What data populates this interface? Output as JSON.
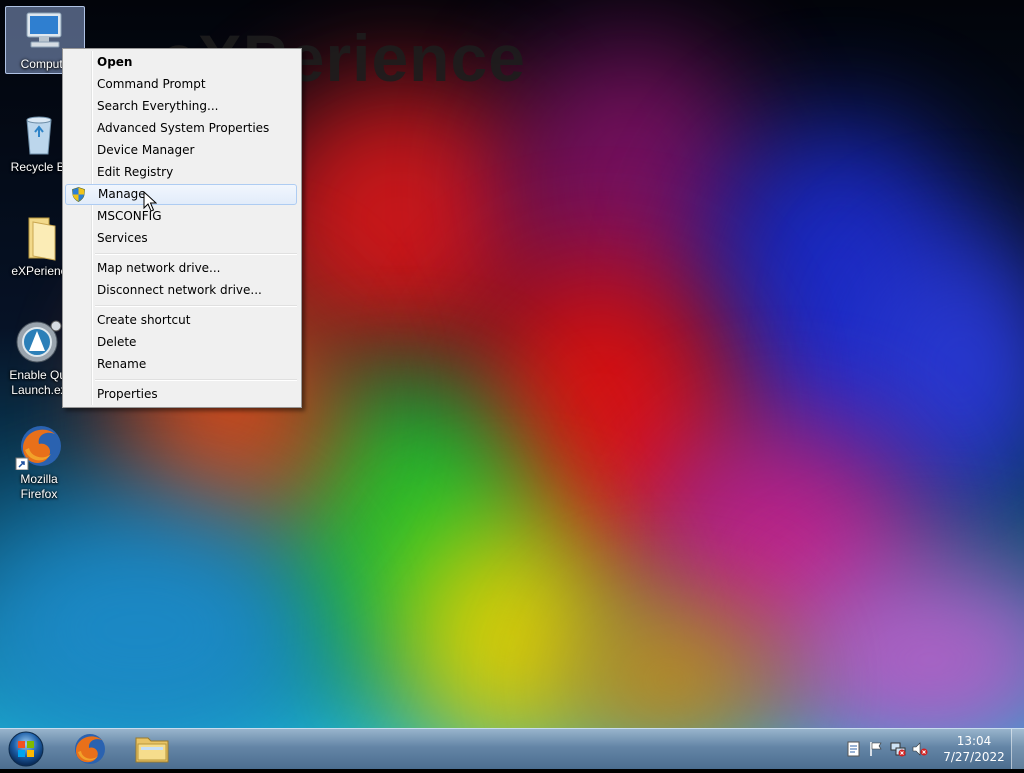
{
  "wallpaper": {
    "watermark": "eXPerience"
  },
  "desktop_icons": [
    {
      "label": "Compute",
      "icon": "computer-icon"
    },
    {
      "label": "Recycle Bi",
      "icon": "recycle-bin-icon"
    },
    {
      "label": "eXPerienc",
      "icon": "folder-icon"
    },
    {
      "label": "Enable Qui",
      "label2": "Launch.ex",
      "icon": "app-launcher-icon"
    },
    {
      "label": "Mozilla",
      "label2": "Firefox",
      "icon": "firefox-icon"
    }
  ],
  "context_menu": {
    "items": [
      "Open",
      "Command Prompt",
      "Search Everything...",
      "Advanced System Properties",
      "Device Manager",
      "Edit Registry",
      "Manage",
      "MSCONFIG",
      "Services",
      "Map network drive...",
      "Disconnect network drive...",
      "Create shortcut",
      "Delete",
      "Rename",
      "Properties"
    ],
    "hovered": "Manage"
  },
  "taskbar": {
    "clock_time": "13:04",
    "clock_date": "7/27/2022",
    "pinned": [
      "start-orb-icon",
      "firefox-icon",
      "explorer-folder-icon"
    ],
    "tray": [
      "action-center-icon",
      "flag-icon",
      "network-icon",
      "volume-muted-icon"
    ]
  }
}
